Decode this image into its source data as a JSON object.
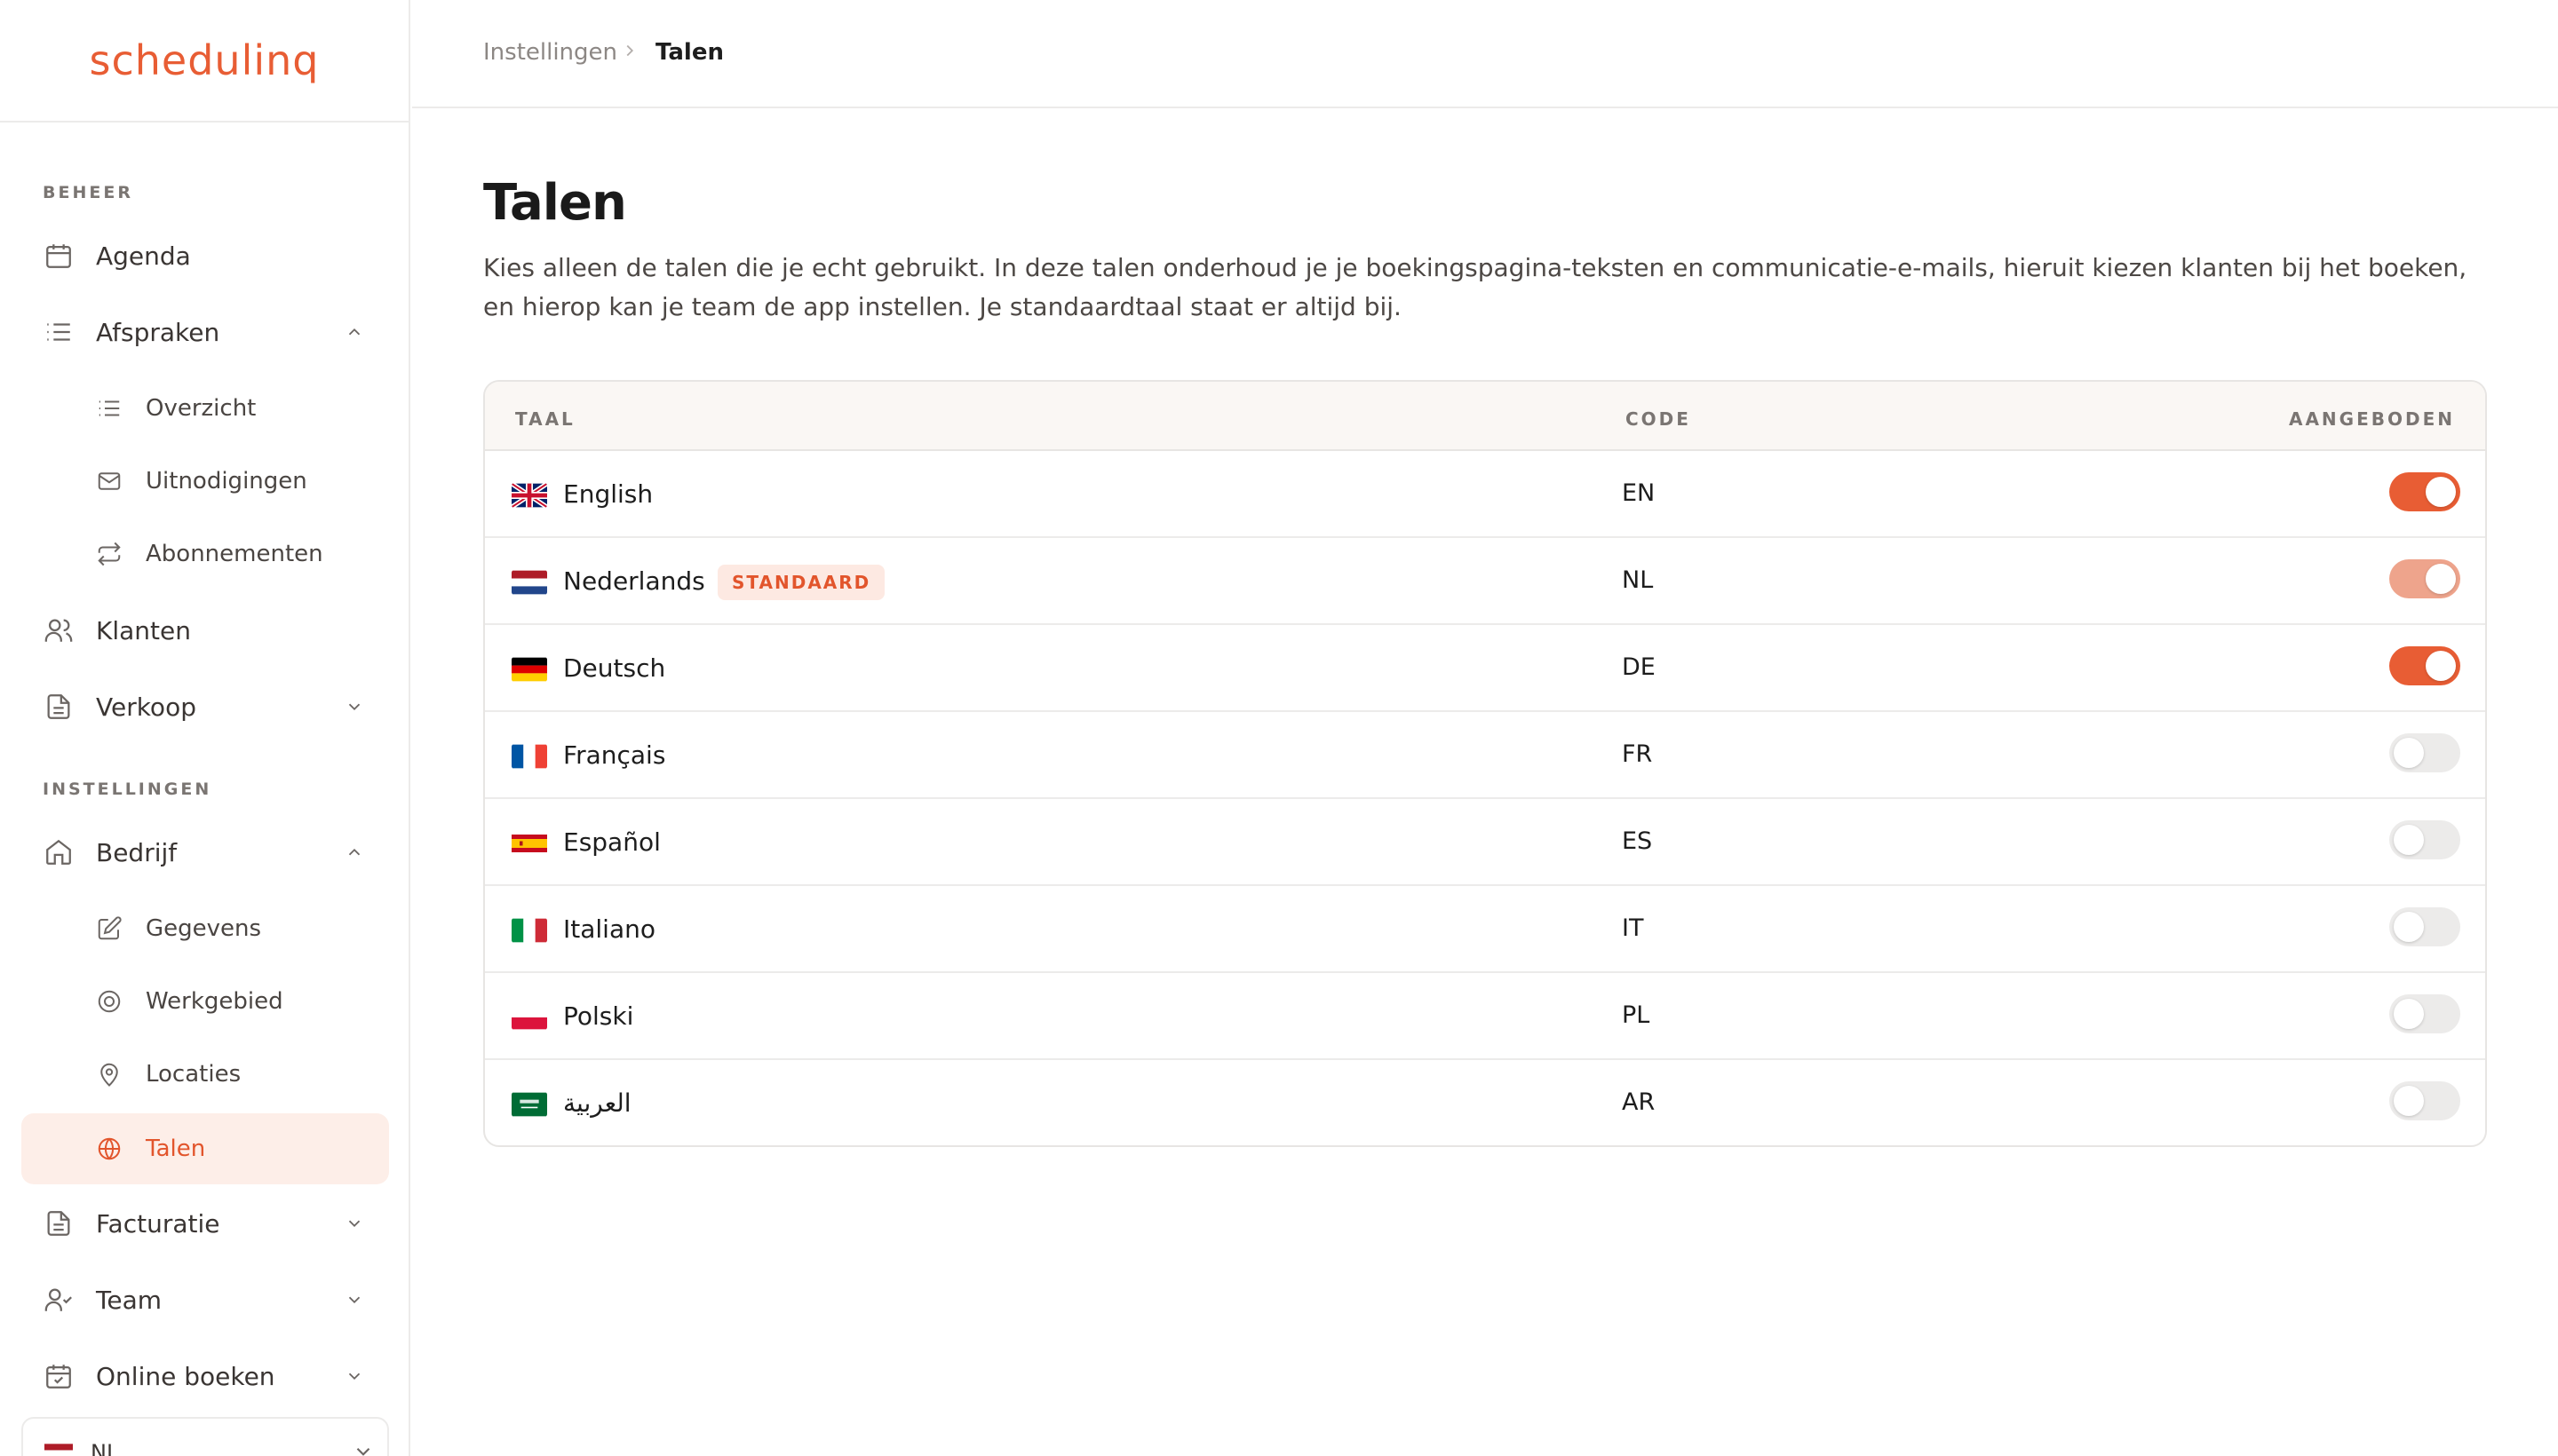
{
  "brand": {
    "logo_text": "schedulinq",
    "accent": "#e85d34"
  },
  "sidebar": {
    "sections": [
      {
        "label": "BEHEER"
      },
      {
        "label": "INSTELLINGEN"
      }
    ],
    "items": [
      {
        "label": "Agenda",
        "icon": "calendar-icon"
      },
      {
        "label": "Afspraken",
        "icon": "list-icon",
        "expanded": true
      },
      {
        "label": "Overzicht",
        "icon": "list-icon"
      },
      {
        "label": "Uitnodigingen",
        "icon": "mail-icon"
      },
      {
        "label": "Abonnementen",
        "icon": "repeat-icon"
      },
      {
        "label": "Klanten",
        "icon": "users-icon"
      },
      {
        "label": "Verkoop",
        "icon": "document-icon",
        "expanded": false
      },
      {
        "label": "Bedrijf",
        "icon": "home-icon",
        "expanded": true
      },
      {
        "label": "Gegevens",
        "icon": "edit-icon"
      },
      {
        "label": "Werkgebied",
        "icon": "target-icon"
      },
      {
        "label": "Locaties",
        "icon": "map-pin-icon"
      },
      {
        "label": "Talen",
        "icon": "globe-icon",
        "active": true
      },
      {
        "label": "Facturatie",
        "icon": "document-icon",
        "expanded": false
      },
      {
        "label": "Team",
        "icon": "user-check-icon",
        "expanded": false
      },
      {
        "label": "Online boeken",
        "icon": "calendar-check-icon",
        "expanded": false
      }
    ],
    "language_select": {
      "value": "NL"
    }
  },
  "breadcrumb": {
    "parent": "Instellingen",
    "current": "Talen"
  },
  "page": {
    "title": "Talen",
    "description": "Kies alleen de talen die je echt gebruikt. In deze talen onderhoud je je boekingspagina-teksten en communicatie-e-mails, hieruit kiezen klanten bij het boeken, en hierop kan je team de app instellen. Je standaardtaal staat er altijd bij."
  },
  "table": {
    "columns": {
      "language": "TAAL",
      "code": "CODE",
      "offered": "AANGEBODEN"
    },
    "default_badge": "STANDAARD",
    "rows": [
      {
        "name": "English",
        "code": "EN",
        "offered": true,
        "flag": "gb-flag-icon"
      },
      {
        "name": "Nederlands",
        "code": "NL",
        "offered": true,
        "default": true,
        "flag": "nl-flag-icon"
      },
      {
        "name": "Deutsch",
        "code": "DE",
        "offered": true,
        "flag": "de-flag-icon"
      },
      {
        "name": "Français",
        "code": "FR",
        "offered": false,
        "flag": "fr-flag-icon"
      },
      {
        "name": "Español",
        "code": "ES",
        "offered": false,
        "flag": "es-flag-icon"
      },
      {
        "name": "Italiano",
        "code": "IT",
        "offered": false,
        "flag": "it-flag-icon"
      },
      {
        "name": "Polski",
        "code": "PL",
        "offered": false,
        "flag": "pl-flag-icon"
      },
      {
        "name": "العربية",
        "code": "AR",
        "offered": false,
        "flag": "sa-flag-icon"
      }
    ]
  },
  "colors": {
    "accent": "#e85d34",
    "toggle_muted": "#eea48c",
    "toggle_off": "#ecebea",
    "active_bg": "#fdeee8"
  }
}
